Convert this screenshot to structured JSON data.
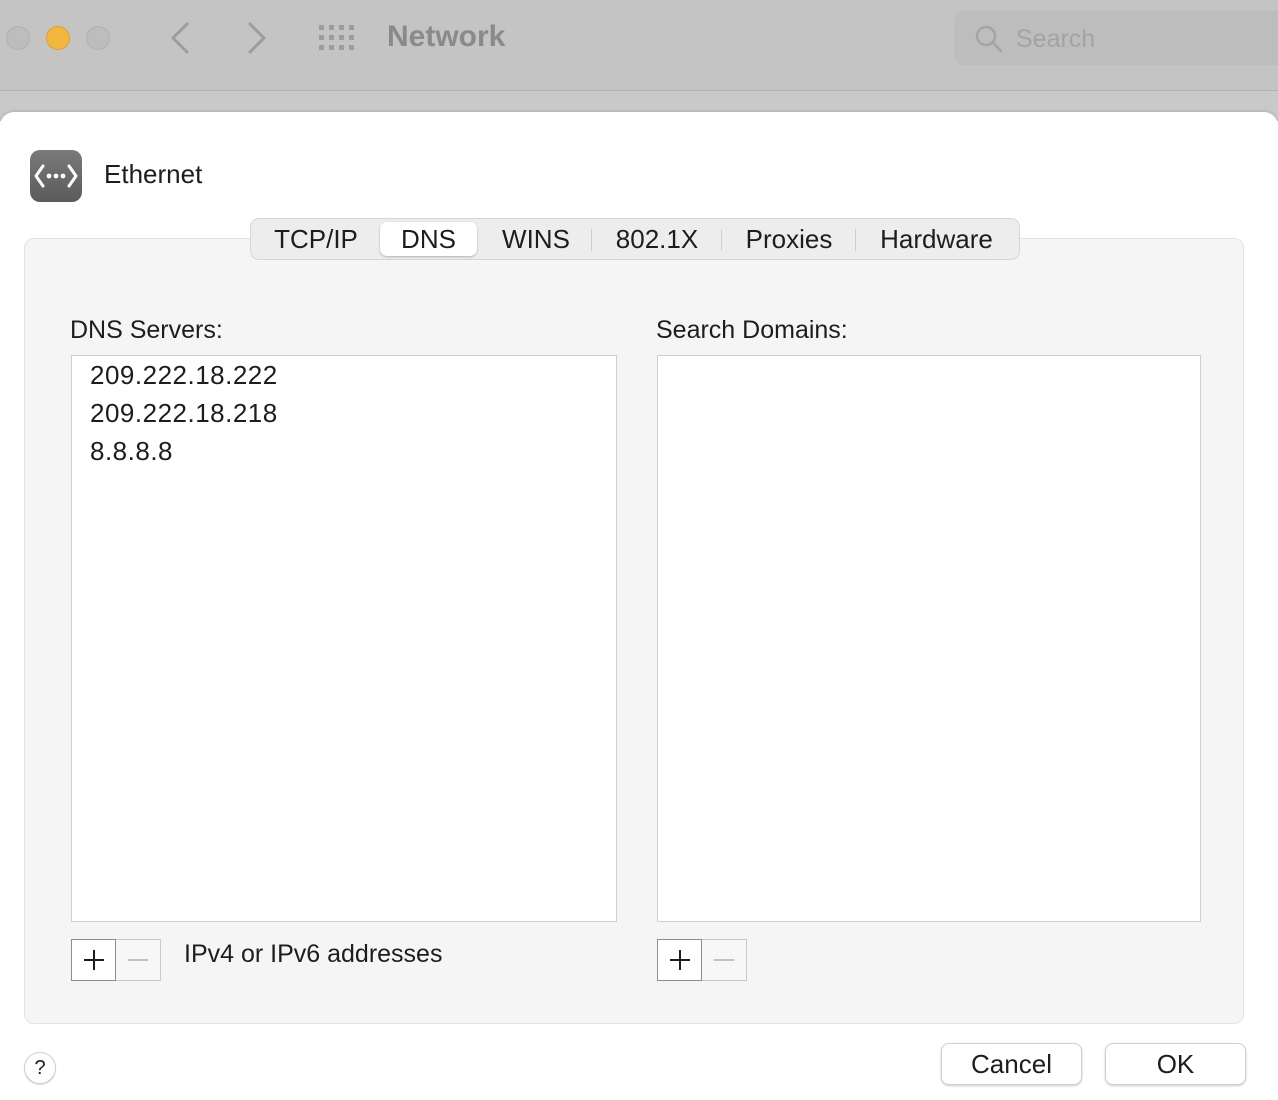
{
  "window": {
    "title": "Network",
    "search_placeholder": "Search"
  },
  "sheet": {
    "service_name": "Ethernet",
    "tabs": [
      {
        "label": "TCP/IP"
      },
      {
        "label": "DNS"
      },
      {
        "label": "WINS"
      },
      {
        "label": "802.1X"
      },
      {
        "label": "Proxies"
      },
      {
        "label": "Hardware"
      }
    ],
    "active_tab": "DNS",
    "dns_servers": {
      "label": "DNS Servers:",
      "items": [
        "209.222.18.222",
        "209.222.18.218",
        "8.8.8.8"
      ],
      "hint": "IPv4 or IPv6 addresses"
    },
    "search_domains": {
      "label": "Search Domains:",
      "items": []
    },
    "help_label": "?",
    "cancel_label": "Cancel",
    "ok_label": "OK"
  },
  "colors": {
    "minimize_light": "#f3b63f",
    "titlebar_dimmed": "#c4c4c4",
    "panel_background": "#f5f5f5"
  },
  "icons": [
    "back-chevron-icon",
    "forward-chevron-icon",
    "app-grid-icon",
    "search-icon",
    "ethernet-icon",
    "plus-icon",
    "minus-icon"
  ]
}
